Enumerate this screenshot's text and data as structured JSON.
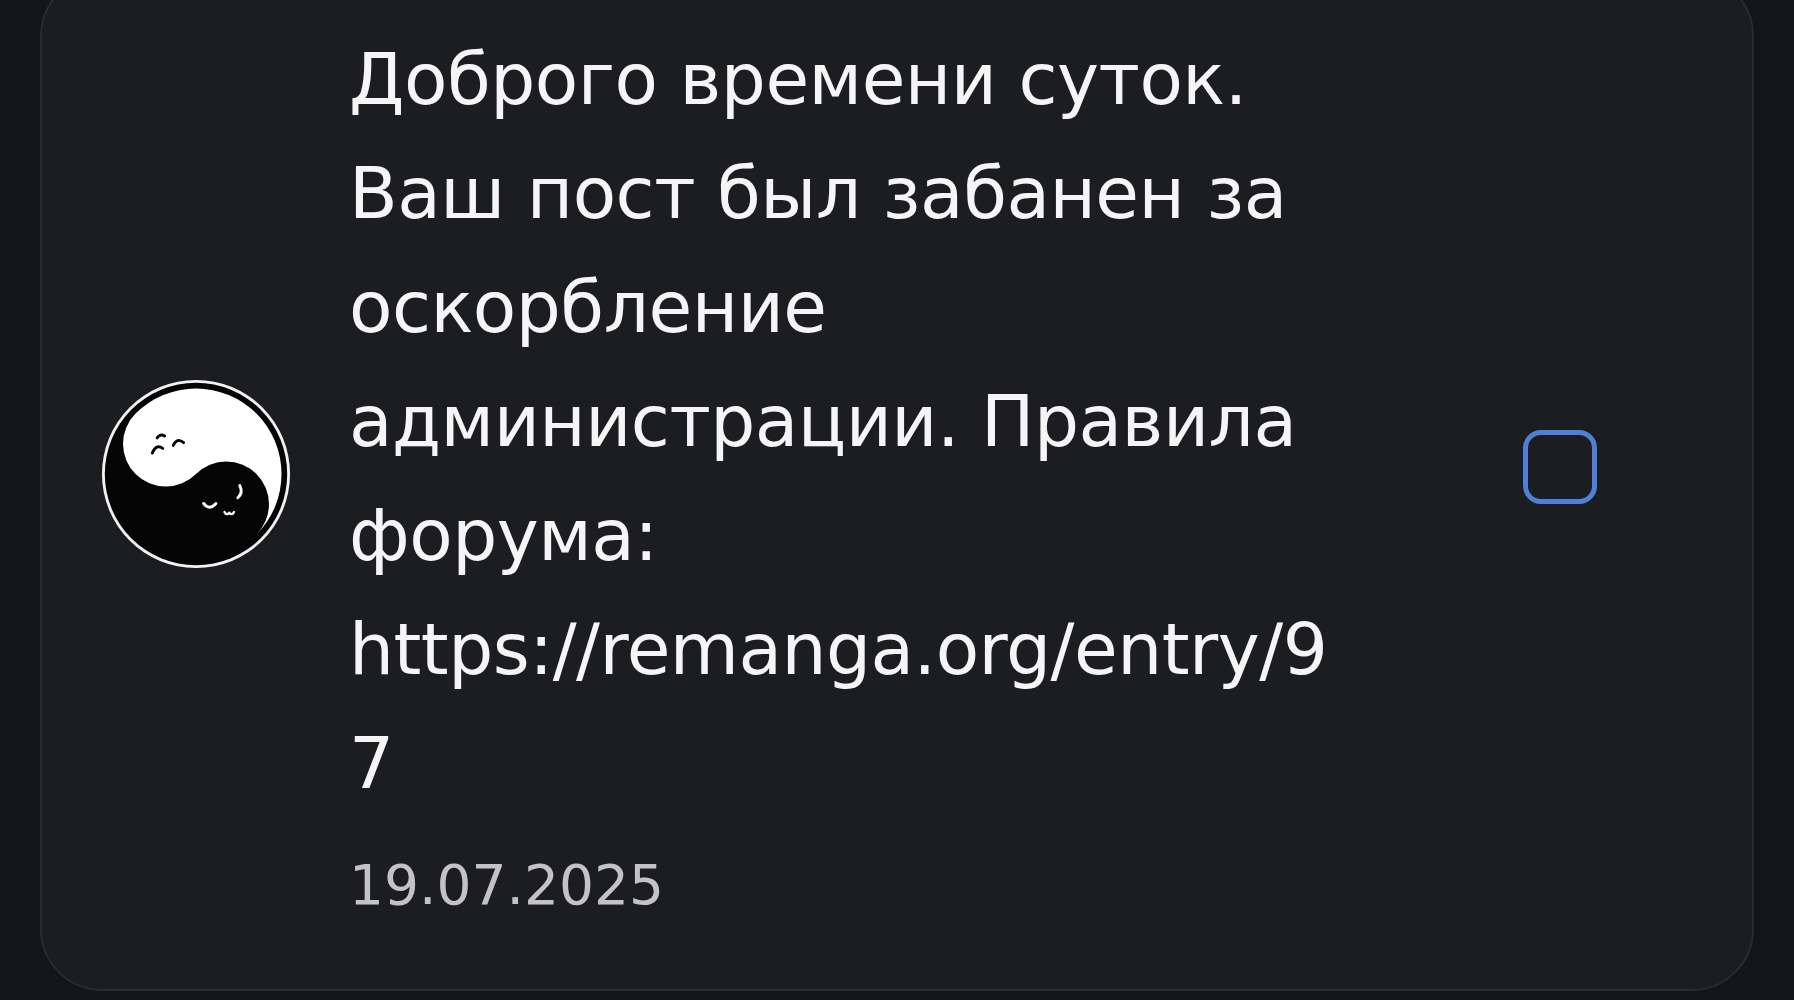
{
  "notification": {
    "text": "Доброго времени суток. Ваш пост был забанен за оскорбление администрации. Правила форума: https://remanga.org/entry/97",
    "date": "19.07.2025",
    "checked": false
  }
}
